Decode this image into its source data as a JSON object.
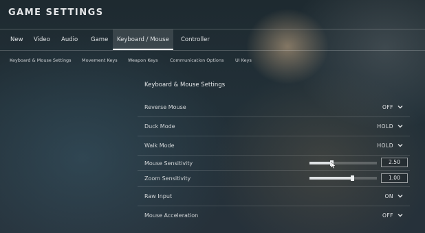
{
  "header": {
    "title": "GAME SETTINGS"
  },
  "main_tabs": [
    {
      "label": "New"
    },
    {
      "label": "Video"
    },
    {
      "label": "Audio"
    },
    {
      "label": "Game"
    },
    {
      "label": "Keyboard / Mouse",
      "active": true
    },
    {
      "label": "Controller"
    }
  ],
  "sub_tabs": [
    {
      "label": "Keyboard & Mouse Settings"
    },
    {
      "label": "Movement Keys"
    },
    {
      "label": "Weapon Keys"
    },
    {
      "label": "Communication Options"
    },
    {
      "label": "UI Keys"
    }
  ],
  "panel": {
    "title": "Keyboard & Mouse Settings",
    "rows": [
      {
        "label": "Reverse Mouse",
        "value": "OFF"
      },
      {
        "label": "Duck Mode",
        "value": "HOLD"
      },
      {
        "label": "Walk Mode",
        "value": "HOLD"
      },
      {
        "label": "Mouse Sensitivity",
        "value": "2.50",
        "fraction": 0.33
      },
      {
        "label": "Zoom Sensitivity",
        "value": "1.00",
        "fraction": 0.63
      },
      {
        "label": "Raw Input",
        "value": "ON"
      },
      {
        "label": "Mouse Acceleration",
        "value": "OFF"
      }
    ]
  },
  "icons": {
    "dropdown": "chevron-down-icon",
    "pointer": "mouse-cursor-icon"
  }
}
